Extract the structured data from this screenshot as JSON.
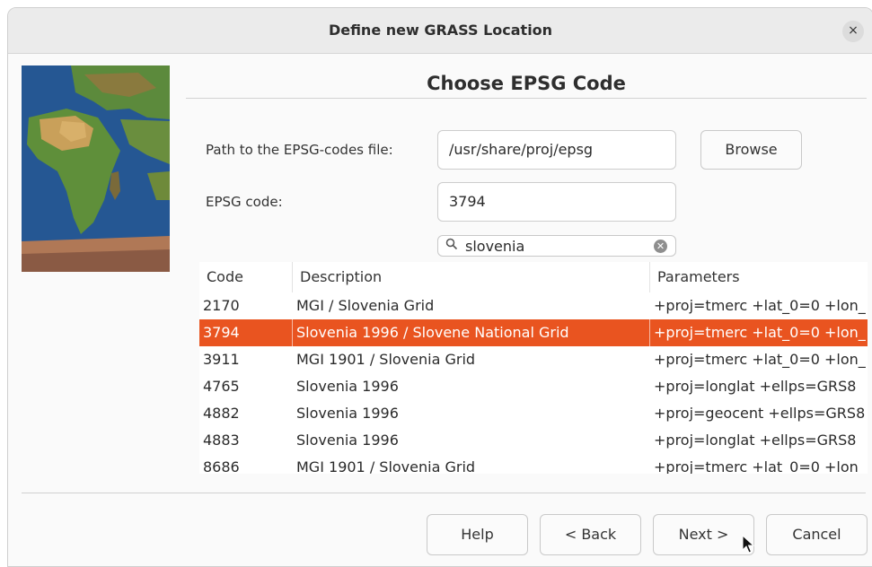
{
  "window": {
    "title": "Define new GRASS Location",
    "close_label": "×"
  },
  "page": {
    "heading": "Choose EPSG Code"
  },
  "form": {
    "path_label": "Path to the EPSG-codes file:",
    "path_value": "/usr/share/proj/epsg",
    "browse_label": "Browse",
    "code_label": "EPSG code:",
    "code_value": "3794",
    "search_value": "slovenia"
  },
  "table": {
    "headers": [
      "Code",
      "Description",
      "Parameters"
    ],
    "selected_code": "3794",
    "rows": [
      {
        "code": "2170",
        "description": "MGI / Slovenia Grid",
        "parameters": "+proj=tmerc +lat_0=0 +lon_"
      },
      {
        "code": "3794",
        "description": "Slovenia 1996 / Slovene National Grid",
        "parameters": "+proj=tmerc +lat_0=0 +lon_"
      },
      {
        "code": "3911",
        "description": "MGI 1901 / Slovenia Grid",
        "parameters": "+proj=tmerc +lat_0=0 +lon_"
      },
      {
        "code": "4765",
        "description": "Slovenia 1996",
        "parameters": "+proj=longlat +ellps=GRS8"
      },
      {
        "code": "4882",
        "description": "Slovenia 1996",
        "parameters": "+proj=geocent +ellps=GRS8"
      },
      {
        "code": "4883",
        "description": "Slovenia 1996",
        "parameters": "+proj=longlat +ellps=GRS8"
      },
      {
        "code": "8686",
        "description": "MGI 1901 / Slovenia Grid",
        "parameters": "+proj=tmerc +lat_0=0 +lon_"
      }
    ]
  },
  "footer": {
    "help_label": "Help",
    "back_label": "< Back",
    "next_label": "Next >",
    "cancel_label": "Cancel"
  },
  "icons": {
    "search": "search-icon",
    "clear": "clear-search-icon",
    "close": "close-icon",
    "cursor": "mouse-pointer-icon"
  },
  "colors": {
    "selection": "#e95420",
    "titlebar": "#ebebeb"
  }
}
